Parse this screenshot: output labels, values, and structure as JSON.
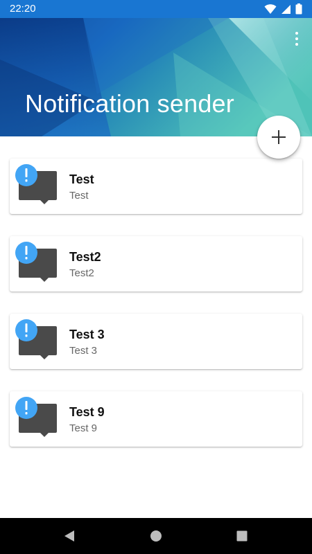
{
  "status_bar": {
    "time": "22:20",
    "icons": [
      "wifi-icon",
      "signal-icon",
      "battery-icon"
    ],
    "color": "#1976d2"
  },
  "header": {
    "title": "Notification sender",
    "menu_icon": "more-vert-icon",
    "colors": [
      "#0d47a1",
      "#1e88e5",
      "#4db6ac",
      "#b2ebf2"
    ]
  },
  "fab": {
    "icon": "plus-icon"
  },
  "notifications": [
    {
      "title": "Test",
      "subtitle": "Test"
    },
    {
      "title": "Test2",
      "subtitle": "Test2"
    },
    {
      "title": "Test 3",
      "subtitle": "Test 3"
    },
    {
      "title": "Test 9",
      "subtitle": "Test 9"
    }
  ],
  "card_icon": {
    "bubble_icon": "chat-bubble-icon",
    "alert_icon": "exclamation-icon",
    "bubble_color": "#4a4a4a",
    "alert_color": "#42a5f5"
  },
  "nav_bar": {
    "back_icon": "back-triangle-icon",
    "home_icon": "home-circle-icon",
    "recents_icon": "recents-square-icon"
  }
}
